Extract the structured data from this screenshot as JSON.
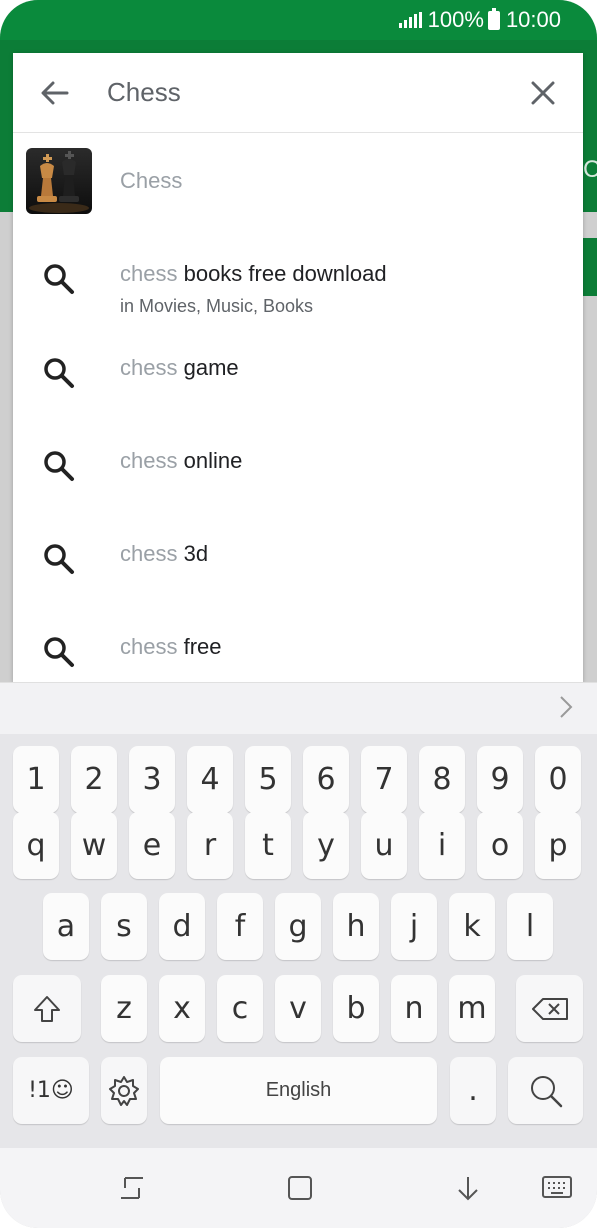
{
  "status_bar": {
    "battery": "100%",
    "time": "10:00"
  },
  "search": {
    "query": "Chess"
  },
  "suggestions": [
    {
      "type": "app",
      "label": "Chess"
    },
    {
      "type": "query",
      "prefix": "chess",
      "rest": " books free download",
      "sub": "in Movies, Music, Books"
    },
    {
      "type": "query",
      "prefix": "chess",
      "rest": " game"
    },
    {
      "type": "query",
      "prefix": "chess",
      "rest": " online"
    },
    {
      "type": "query",
      "prefix": "chess",
      "rest": " 3d"
    },
    {
      "type": "query",
      "prefix": "chess",
      "rest": " free"
    }
  ],
  "keyboard": {
    "rows": [
      [
        "1",
        "2",
        "3",
        "4",
        "5",
        "6",
        "7",
        "8",
        "9",
        "0"
      ],
      [
        "q",
        "w",
        "e",
        "r",
        "t",
        "y",
        "u",
        "i",
        "o",
        "p"
      ],
      [
        "a",
        "s",
        "d",
        "f",
        "g",
        "h",
        "j",
        "k",
        "l"
      ],
      [
        "z",
        "x",
        "c",
        "v",
        "b",
        "n",
        "m"
      ]
    ],
    "symbols_key": "!1☺",
    "space_label": "English",
    "period": "."
  },
  "colors": {
    "brand_green": "#0c7d37",
    "status_green": "#0a8a3c"
  }
}
